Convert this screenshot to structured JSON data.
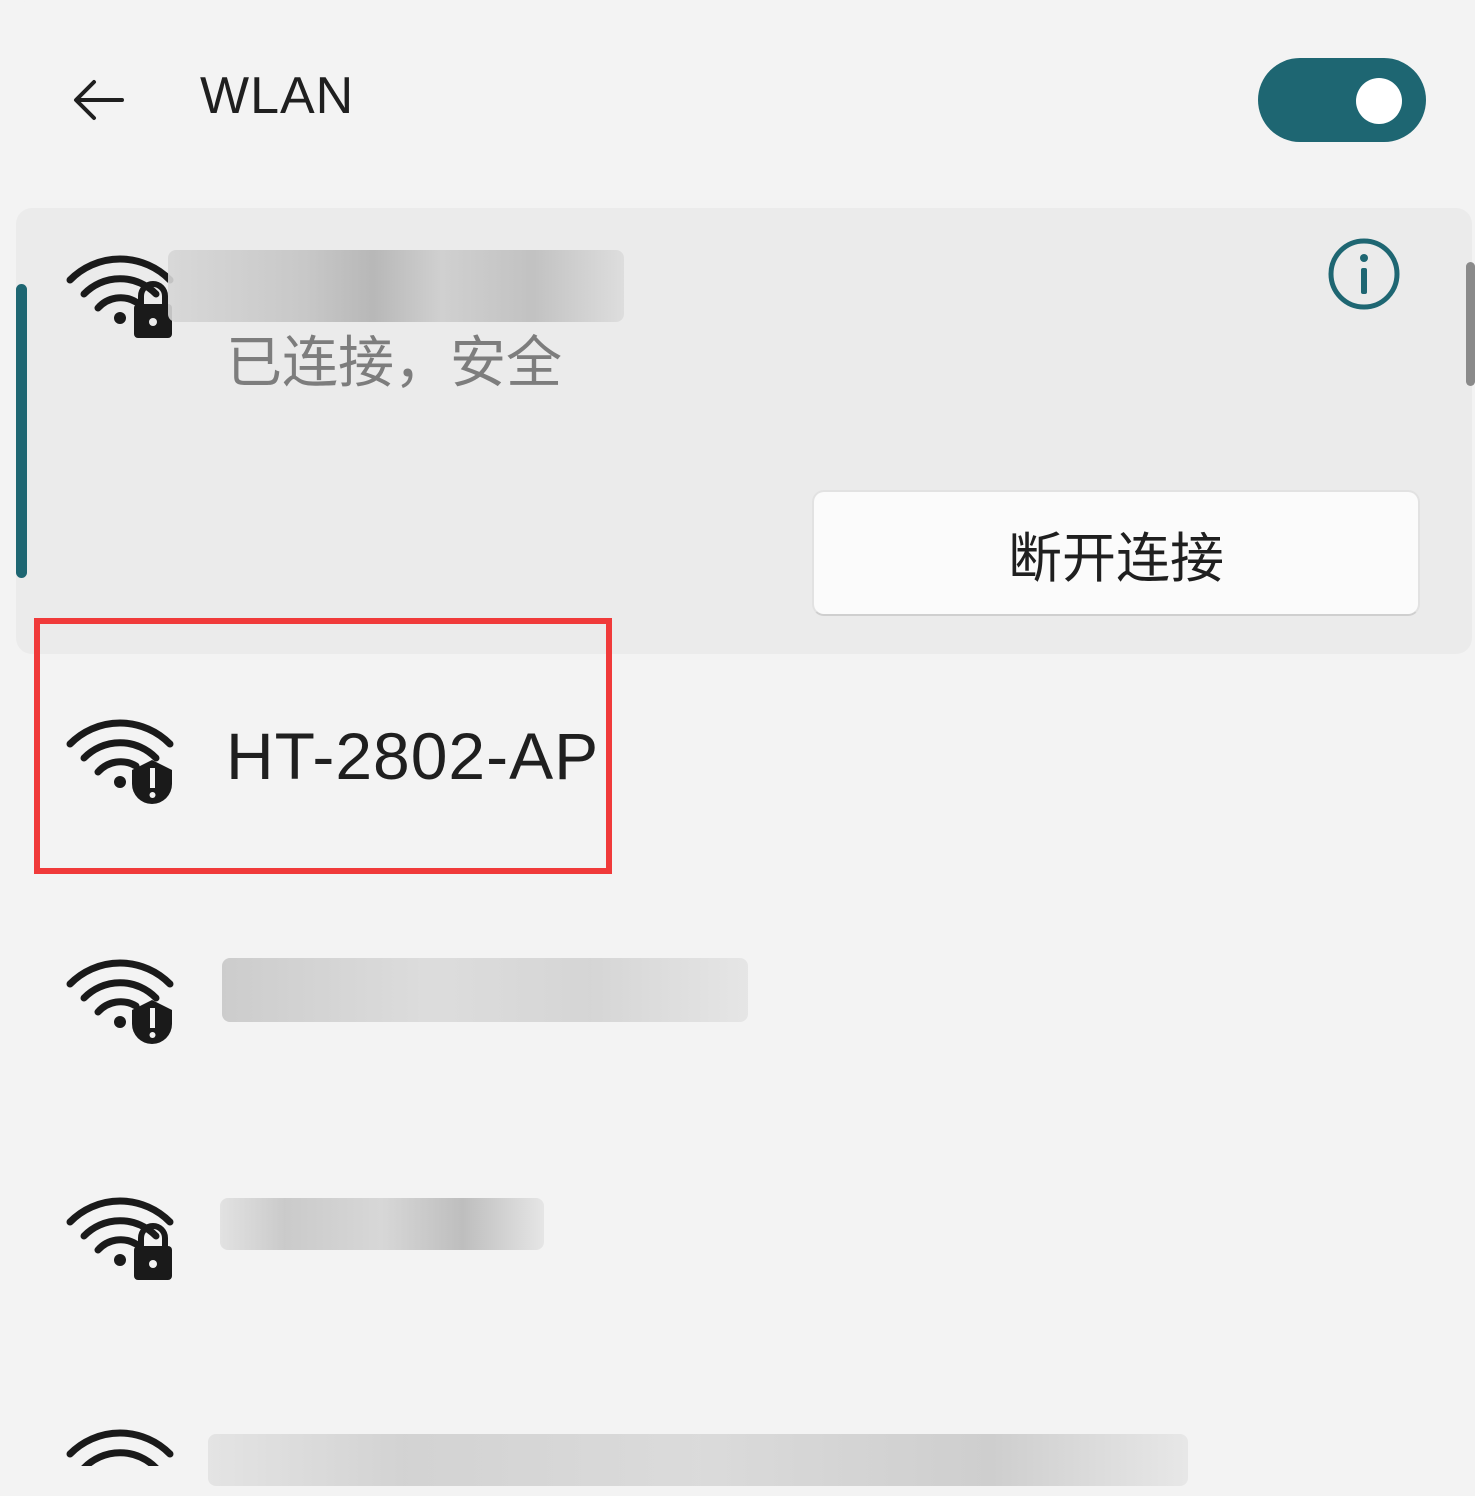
{
  "header": {
    "title": "WLAN",
    "wifi_enabled": true,
    "accent_color": "#1e6672"
  },
  "connected": {
    "status": "已连接，安全",
    "disconnect_label": "断开连接",
    "icon": "wifi-secured-icon"
  },
  "networks": [
    {
      "name": "HT-2802-AP",
      "icon": "wifi-warning-icon",
      "highlighted": true
    },
    {
      "icon": "wifi-warning-icon"
    },
    {
      "icon": "wifi-secured-icon"
    },
    {
      "icon": "wifi-icon"
    }
  ],
  "highlight_color": "#f03a3a"
}
